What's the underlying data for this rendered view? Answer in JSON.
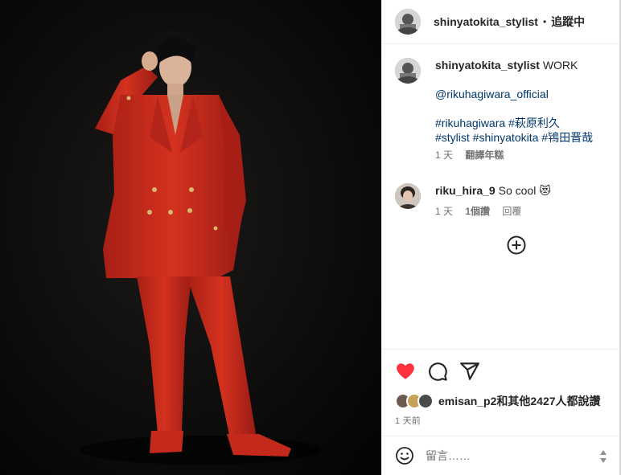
{
  "post": {
    "author": "shinyatokita_stylist",
    "separator": "•",
    "follow_label": "追蹤中"
  },
  "caption": {
    "username": "shinyatokita_stylist",
    "title": "WORK",
    "mention": "@rikuhagiwara_official",
    "hashtags_line1": "#rikuhagiwara #萩原利久",
    "hashtags_line2": "#stylist #shinyatokita #鴇田晋哉",
    "time": "1 天",
    "translate_label": "翻譯年糕"
  },
  "comment": {
    "username": "riku_hira_9",
    "text": "So cool 😻",
    "time": "1 天",
    "likes": "1個讚",
    "reply_label": "回覆"
  },
  "actions": {
    "icons": [
      "heart-icon",
      "comment-icon",
      "share-icon"
    ],
    "like_color": "#ff3040"
  },
  "likes": {
    "text": "emisan_p2和其他2427人都說讚"
  },
  "timestamp": "1 天前",
  "add_comment": {
    "placeholder": "留言……",
    "icon": "emoji-icon"
  },
  "photo": {
    "description_icon": "post-photo",
    "suit_color": "#c8281e",
    "background_color": "#0a0a0a"
  }
}
